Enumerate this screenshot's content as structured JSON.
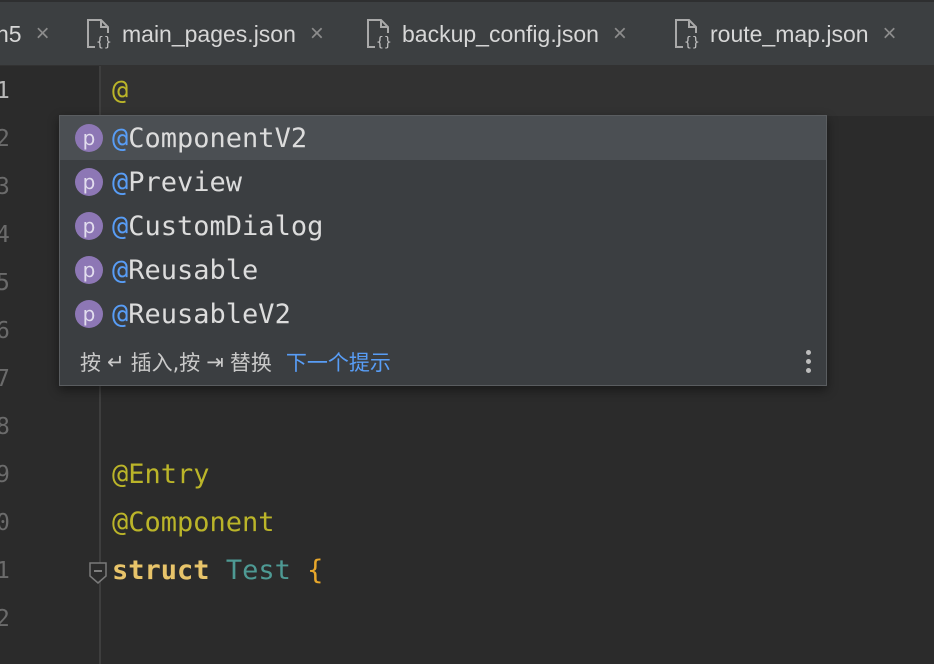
{
  "tabs": [
    {
      "label": "n5",
      "close": "×"
    },
    {
      "label": "main_pages.json",
      "close": "×"
    },
    {
      "label": "backup_config.json",
      "close": "×"
    },
    {
      "label": "route_map.json",
      "close": "×"
    }
  ],
  "editor": {
    "line_numbers": [
      "1",
      "2",
      "3",
      "4",
      "5",
      "6",
      "7",
      "8",
      "9",
      "0",
      "1",
      "2"
    ],
    "active_line_text": "@",
    "lines": {
      "entry": "@Entry",
      "component": "@Component",
      "struct_kw": "struct",
      "struct_name": "Test",
      "brace": "{"
    }
  },
  "completion": {
    "badge": "p",
    "items": [
      {
        "at": "@",
        "rest": "ComponentV2"
      },
      {
        "at": "@",
        "rest": "Preview"
      },
      {
        "at": "@",
        "rest": "CustomDialog"
      },
      {
        "at": "@",
        "rest": "Reusable"
      },
      {
        "at": "@",
        "rest": "ReusableV2"
      }
    ],
    "hint_press": "按",
    "hint_enter_symbol": "↵",
    "hint_insert": "插入,按",
    "hint_tab_symbol": "⇥",
    "hint_replace": "替换",
    "hint_next": "下一个提示"
  },
  "colors": {
    "background": "#2b2b2b",
    "annotation": "#bbb529",
    "keyword": "#e8c46a",
    "accent": "#589df6",
    "badge": "#8d77b5"
  }
}
